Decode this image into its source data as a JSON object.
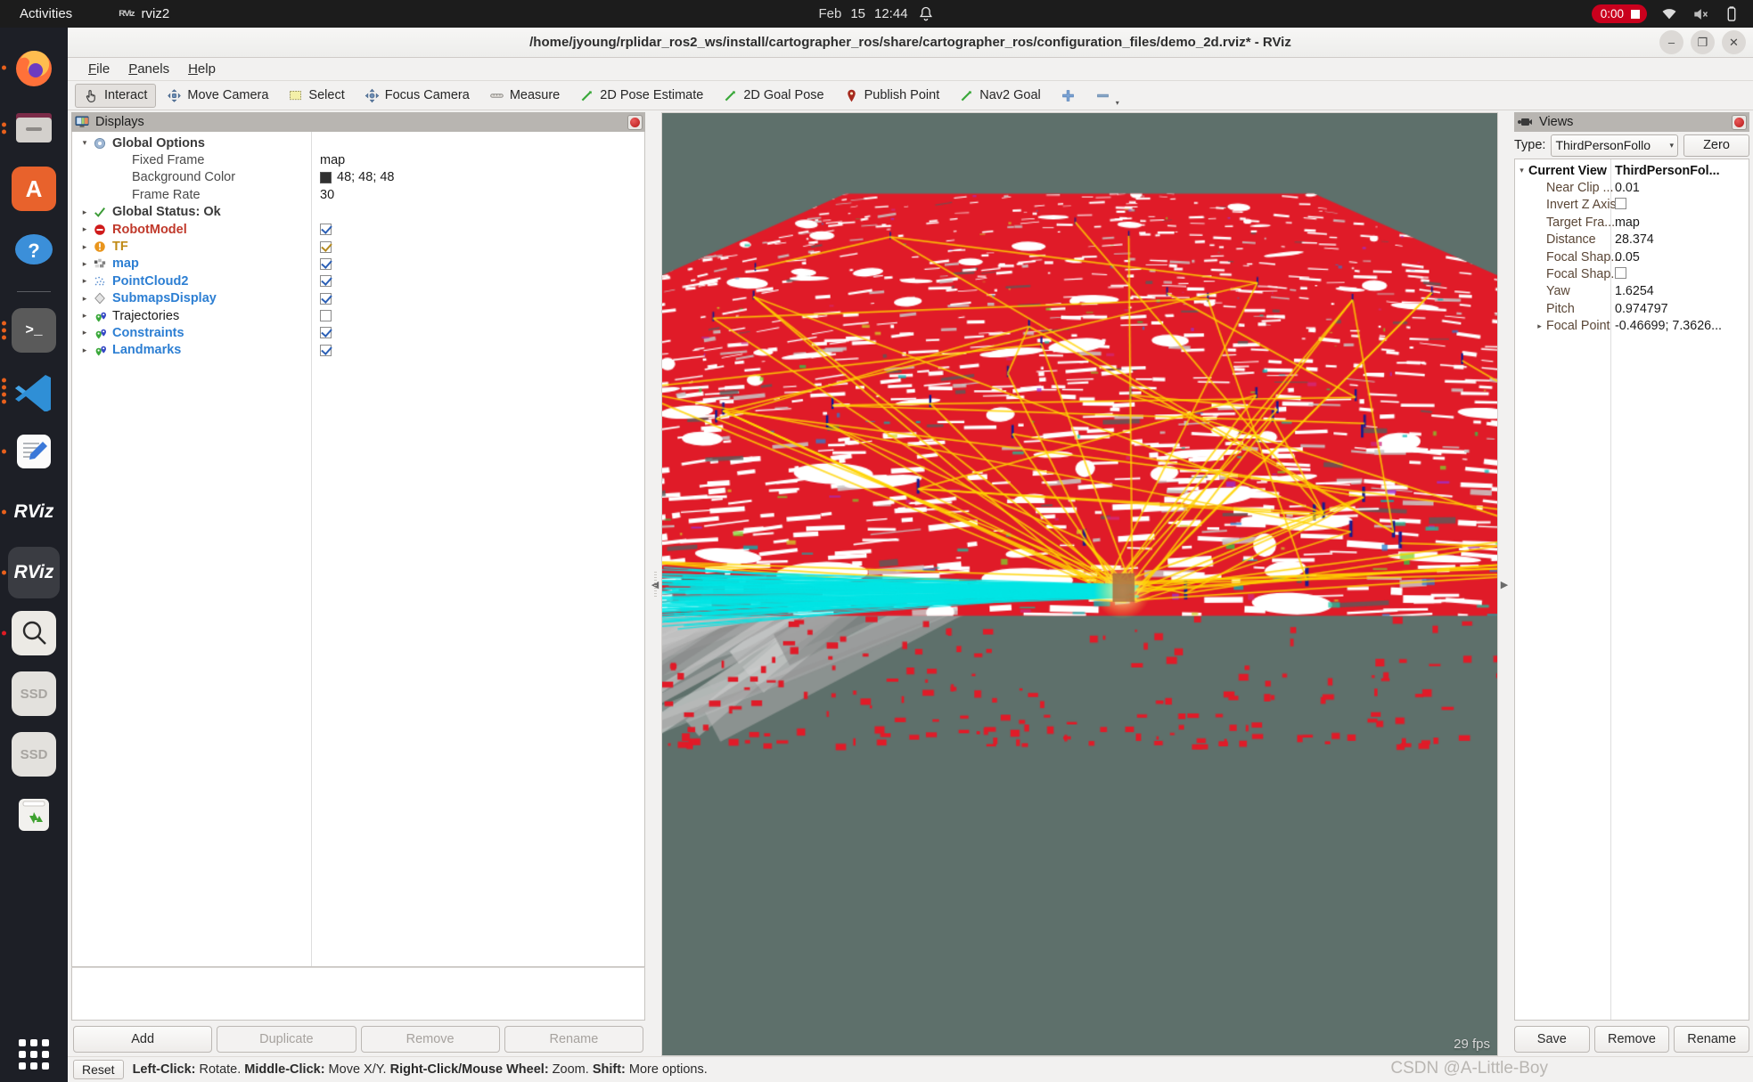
{
  "topbar": {
    "activities": "Activities",
    "app_icon": "rviz-icon",
    "app_name": "rviz2",
    "clock_month": "Feb",
    "clock_day": "15",
    "clock_time": "12:44",
    "bell_icon": "bell-icon",
    "recording_time": "0:00",
    "icons": [
      "wifi-icon",
      "volume-muted-icon",
      "battery-icon"
    ]
  },
  "dock": {
    "items": [
      {
        "name": "firefox",
        "icon": "firefox-icon",
        "dots": 1,
        "active": false
      },
      {
        "name": "files",
        "icon": "files-icon",
        "dots": 2,
        "active": false
      },
      {
        "name": "software",
        "icon": "ubuntu-software-icon",
        "dots": 0,
        "active": false
      },
      {
        "name": "help",
        "icon": "help-icon",
        "dots": 0,
        "active": false
      },
      {
        "name": "terminal",
        "icon": "terminal-icon",
        "dots": 3,
        "active": false
      },
      {
        "name": "vscode",
        "icon": "vscode-icon",
        "dots": 4,
        "active": false
      },
      {
        "name": "text-editor",
        "icon": "text-editor-icon",
        "dots": 1,
        "active": false
      },
      {
        "name": "rviz-1",
        "icon": "rviz-icon",
        "dots": 1,
        "active": false
      },
      {
        "name": "rviz-2",
        "icon": "rviz-icon",
        "dots": 1,
        "active": true
      },
      {
        "name": "search",
        "icon": "magnifier-icon",
        "dots": 1,
        "active": false
      },
      {
        "name": "ssd-1",
        "icon": "drive-icon",
        "dots": 0,
        "active": false
      },
      {
        "name": "ssd-2",
        "icon": "drive-icon",
        "dots": 0,
        "active": false
      },
      {
        "name": "trash",
        "icon": "trash-icon",
        "dots": 0,
        "active": false
      }
    ],
    "show_apps": "show-applications"
  },
  "window": {
    "title": "/home/jyoung/rplidar_ros2_ws/install/cartographer_ros/share/cartographer_ros/configuration_files/demo_2d.rviz* - RViz",
    "minimize": "–",
    "maximize": "❐",
    "close": "✕"
  },
  "menubar": {
    "items": [
      "File",
      "Panels",
      "Help"
    ]
  },
  "toolbar": {
    "items": [
      {
        "label": "Interact",
        "icon": "hand-cursor-icon",
        "checked": true
      },
      {
        "label": "Move Camera",
        "icon": "move-camera-icon",
        "checked": false
      },
      {
        "label": "Select",
        "icon": "select-rect-icon",
        "checked": false
      },
      {
        "label": "Focus Camera",
        "icon": "focus-camera-icon",
        "checked": false
      },
      {
        "label": "Measure",
        "icon": "measure-icon",
        "checked": false
      },
      {
        "label": "2D Pose Estimate",
        "icon": "pose-arrow-icon",
        "checked": false
      },
      {
        "label": "2D Goal Pose",
        "icon": "pose-arrow-icon",
        "checked": false
      },
      {
        "label": "Publish Point",
        "icon": "map-pin-icon",
        "checked": false
      },
      {
        "label": "Nav2 Goal",
        "icon": "pose-arrow-icon",
        "checked": false
      },
      {
        "label": "",
        "icon": "plus-icon",
        "checked": false
      },
      {
        "label": "",
        "icon": "minus-icon",
        "checked": false
      }
    ]
  },
  "displays": {
    "panel_title": "Displays",
    "panel_icon": "displays-monitor-icon",
    "close_icon": "close-panel-icon",
    "rows": [
      {
        "indent": 0,
        "expander": "▾",
        "icon": "gear-icon",
        "label": "Global Options",
        "style": "nm-dark",
        "value": "",
        "value_type": "none"
      },
      {
        "indent": 1,
        "expander": "",
        "icon": "",
        "label": "Fixed Frame",
        "style": "prop",
        "value": "map",
        "value_type": "text"
      },
      {
        "indent": 1,
        "expander": "",
        "icon": "",
        "label": "Background Color",
        "style": "prop",
        "value": "48; 48; 48",
        "value_type": "color",
        "swatch": "#303030"
      },
      {
        "indent": 1,
        "expander": "",
        "icon": "",
        "label": "Frame Rate",
        "style": "prop",
        "value": "30",
        "value_type": "text"
      },
      {
        "indent": 0,
        "expander": "▸",
        "icon": "check-ok-icon",
        "label": "Global Status: Ok",
        "style": "nm-dark",
        "value": "",
        "value_type": "none"
      },
      {
        "indent": 0,
        "expander": "▸",
        "icon": "error-icon",
        "label": "RobotModel",
        "style": "nm-red",
        "value": "",
        "value_type": "checkbox",
        "checked": true,
        "cbstyle": "red"
      },
      {
        "indent": 0,
        "expander": "▸",
        "icon": "warning-icon",
        "label": "TF",
        "style": "nm-amber",
        "value": "",
        "value_type": "checkbox",
        "checked": true,
        "cbstyle": "amber"
      },
      {
        "indent": 0,
        "expander": "▸",
        "icon": "map-grid-icon",
        "label": "map",
        "style": "nm-blue",
        "value": "",
        "value_type": "checkbox",
        "checked": true,
        "cbstyle": "blue"
      },
      {
        "indent": 0,
        "expander": "▸",
        "icon": "pointcloud-icon",
        "label": "PointCloud2",
        "style": "nm-blue",
        "value": "",
        "value_type": "checkbox",
        "checked": true,
        "cbstyle": "blue"
      },
      {
        "indent": 0,
        "expander": "▸",
        "icon": "submap-diamond-icon",
        "label": "SubmapsDisplay",
        "style": "nm-blue",
        "value": "",
        "value_type": "checkbox",
        "checked": true,
        "cbstyle": "blue"
      },
      {
        "indent": 0,
        "expander": "▸",
        "icon": "trajectory-icon",
        "label": "Trajectories",
        "style": "nm-plain",
        "value": "",
        "value_type": "checkbox",
        "checked": false,
        "cbstyle": "blue"
      },
      {
        "indent": 0,
        "expander": "▸",
        "icon": "trajectory-icon",
        "label": "Constraints",
        "style": "nm-blue",
        "value": "",
        "value_type": "checkbox",
        "checked": true,
        "cbstyle": "blue"
      },
      {
        "indent": 0,
        "expander": "▸",
        "icon": "trajectory-icon",
        "label": "Landmarks",
        "style": "nm-blue",
        "value": "",
        "value_type": "checkbox",
        "checked": true,
        "cbstyle": "blue"
      }
    ],
    "buttons": [
      {
        "label": "Add",
        "enabled": true
      },
      {
        "label": "Duplicate",
        "enabled": false
      },
      {
        "label": "Remove",
        "enabled": false
      },
      {
        "label": "Rename",
        "enabled": false
      }
    ]
  },
  "views": {
    "panel_title": "Views",
    "panel_icon": "views-camera-icon",
    "close_icon": "close-panel-icon",
    "type_label": "Type:",
    "type_value": "ThirdPersonFollo",
    "zero_label": "Zero",
    "rows": [
      {
        "indent": 0,
        "expander": "▾",
        "key": "Current View",
        "value": "ThirdPersonFol...",
        "header": true,
        "type": "text"
      },
      {
        "indent": 1,
        "expander": "",
        "key": "Near Clip ...",
        "value": "0.01",
        "header": false,
        "type": "text"
      },
      {
        "indent": 1,
        "expander": "",
        "key": "Invert Z Axis",
        "value": "",
        "header": false,
        "type": "checkbox",
        "checked": false
      },
      {
        "indent": 1,
        "expander": "",
        "key": "Target Fra...",
        "value": "map",
        "header": false,
        "type": "text"
      },
      {
        "indent": 1,
        "expander": "",
        "key": "Distance",
        "value": "28.374",
        "header": false,
        "type": "text"
      },
      {
        "indent": 1,
        "expander": "",
        "key": "Focal Shap...",
        "value": "0.05",
        "header": false,
        "type": "text"
      },
      {
        "indent": 1,
        "expander": "",
        "key": "Focal Shap...",
        "value": "",
        "header": false,
        "type": "checkbox",
        "checked": false
      },
      {
        "indent": 1,
        "expander": "",
        "key": "Yaw",
        "value": "1.6254",
        "header": false,
        "type": "text"
      },
      {
        "indent": 1,
        "expander": "",
        "key": "Pitch",
        "value": "0.974797",
        "header": false,
        "type": "text"
      },
      {
        "indent": 1,
        "expander": "▸",
        "key": "Focal Point",
        "value": "-0.46699; 7.3626...",
        "header": false,
        "type": "text"
      }
    ],
    "buttons": [
      {
        "label": "Save",
        "enabled": true
      },
      {
        "label": "Remove",
        "enabled": true
      },
      {
        "label": "Rename",
        "enabled": true
      }
    ]
  },
  "viewport": {
    "background_color": "#5e706b",
    "fps": "29 fps",
    "collapse_left_icon": "collapse-left-arrow",
    "collapse_right_icon": "collapse-right-arrow",
    "render_colors": {
      "occupied": "#e01b28",
      "free": "#ffffff",
      "floor": "#9a9a9a",
      "constraint_inter": "#ffd400",
      "constraint_intra": "#00e5e5",
      "landmark": "#1a1a8c"
    }
  },
  "statusbar": {
    "reset_label": "Reset",
    "hint_segments": [
      {
        "text": "Left-Click:",
        "bold": true
      },
      {
        "text": " Rotate. ",
        "bold": false
      },
      {
        "text": "Middle-Click:",
        "bold": true
      },
      {
        "text": " Move X/Y. ",
        "bold": false
      },
      {
        "text": "Right-Click/Mouse Wheel:",
        "bold": true
      },
      {
        "text": " Zoom. ",
        "bold": false
      },
      {
        "text": "Shift:",
        "bold": true
      },
      {
        "text": " More options.",
        "bold": false
      }
    ]
  },
  "watermark": "CSDN @A-Little-Boy"
}
